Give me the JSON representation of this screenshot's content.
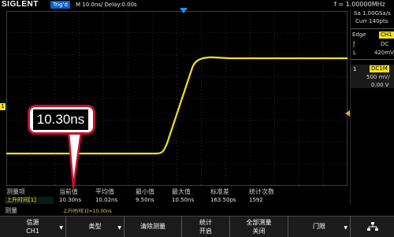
{
  "top": {
    "brand": "SIGLENT",
    "trig_state": "Trig'd",
    "timebase": "M 10.0ns/  Delay:0.00s",
    "frequency": "f = 1.00000MHz"
  },
  "right_panel": {
    "sample_rate": "Sa 1.00GSa/s",
    "memory": "Curr 140pts",
    "trigger_type": "Edge",
    "trigger_source": "CH1",
    "coupling": "DC",
    "level_label": "L",
    "level_value": "420mV",
    "channel_number": "1",
    "channel_coupling": "DC1M",
    "channel_scale": "500 mV/",
    "channel_offset": "0.00 V"
  },
  "measurement": {
    "headers": [
      "测量项",
      "当前值",
      "平均值",
      "最小值",
      "最大值",
      "标准差",
      "统计次数"
    ],
    "row": {
      "name": "上升时间[1]",
      "values": [
        "10.30ns",
        "10.02ns",
        "9.50ns",
        "10.50ns",
        "163.50ps",
        "1592"
      ]
    },
    "panel_label": "测量",
    "sub_label": "上升时间[1]=10.30ns"
  },
  "callout": {
    "value": "10.30ns"
  },
  "softkeys": [
    {
      "line1": "信源",
      "line2": "CH1",
      "arrow": true
    },
    {
      "line1": "类型",
      "line2": "",
      "arrow": true
    },
    {
      "line1": "清除测量",
      "line2": "",
      "arrow": false
    },
    {
      "line1": "统计",
      "line2": "开启",
      "arrow": false
    },
    {
      "line1": "全部测量",
      "line2": "关闭",
      "arrow": false
    },
    {
      "line1": "门限",
      "line2": "",
      "arrow": true
    }
  ],
  "colors": {
    "trace": "#f2e21a",
    "grid": "#5a5a5a",
    "trig_state_bg": "#0a5fc9",
    "callout_border": "#c8102e",
    "channel_badge": "#f2e21a"
  },
  "icons": [
    "trigger-position-icon",
    "trigger-level-icon",
    "channel-marker-icon",
    "softkey-arrow-icon",
    "network-icon"
  ]
}
